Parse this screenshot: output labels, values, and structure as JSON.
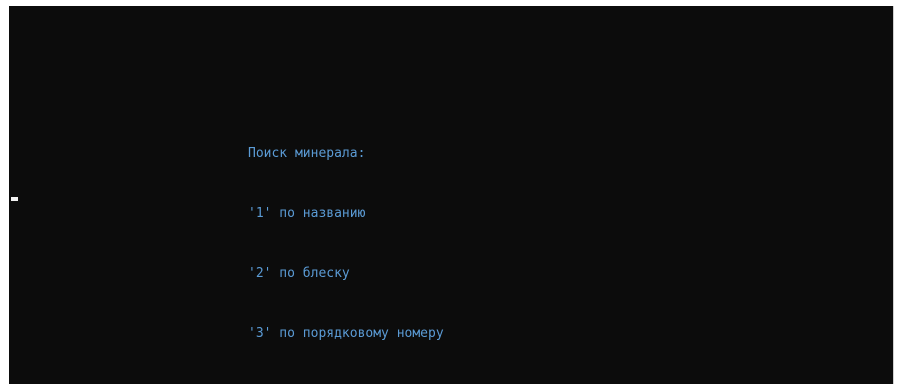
{
  "console": {
    "background": "#0c0c0c",
    "text_color": "#5b9bd5",
    "lines": [
      "Поиск минерала:",
      "'1' по названию",
      "'2' по блеску",
      "'3' по порядковому номеру"
    ]
  }
}
